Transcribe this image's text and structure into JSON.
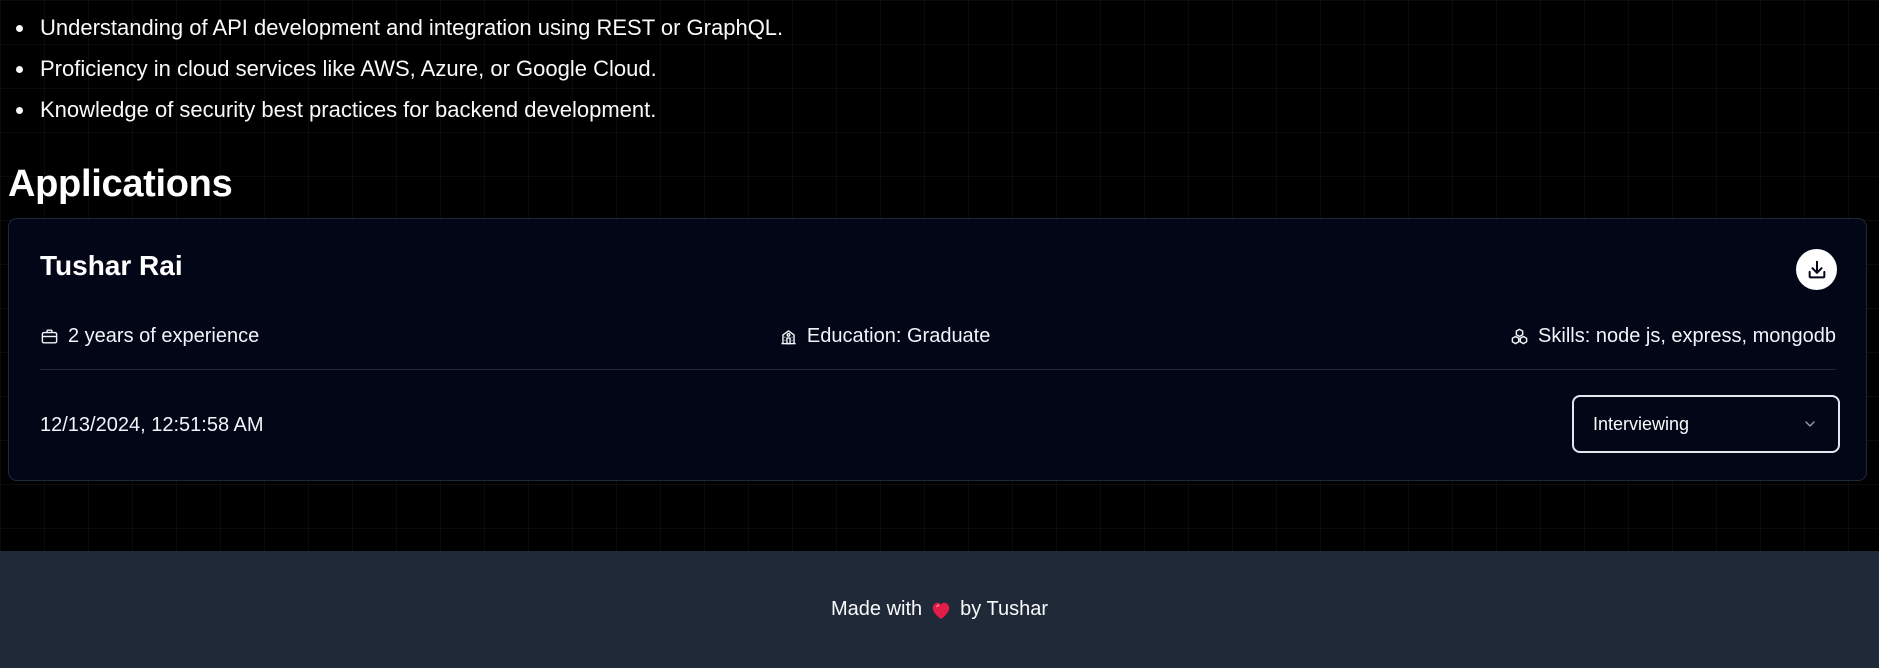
{
  "requirements": [
    "Understanding of API development and integration using REST or GraphQL.",
    "Proficiency in cloud services like AWS, Azure, or Google Cloud.",
    "Knowledge of security best practices for backend development."
  ],
  "applications": {
    "heading": "Applications",
    "items": [
      {
        "name": "Tushar Rai",
        "download_icon": "download-icon",
        "experience": "2 years of experience",
        "education": "Education: Graduate",
        "skills": "Skills: node js, express, mongodb",
        "submitted": "12/13/2024, 12:51:58 AM",
        "status": "Interviewing"
      }
    ]
  },
  "footer": {
    "prefix": "Made with",
    "suffix": "by Tushar",
    "heart_icon": "heart-icon"
  },
  "colors": {
    "background": "#000000",
    "card": "#020617",
    "footer": "#1f2937",
    "heart": "#e11d48"
  }
}
